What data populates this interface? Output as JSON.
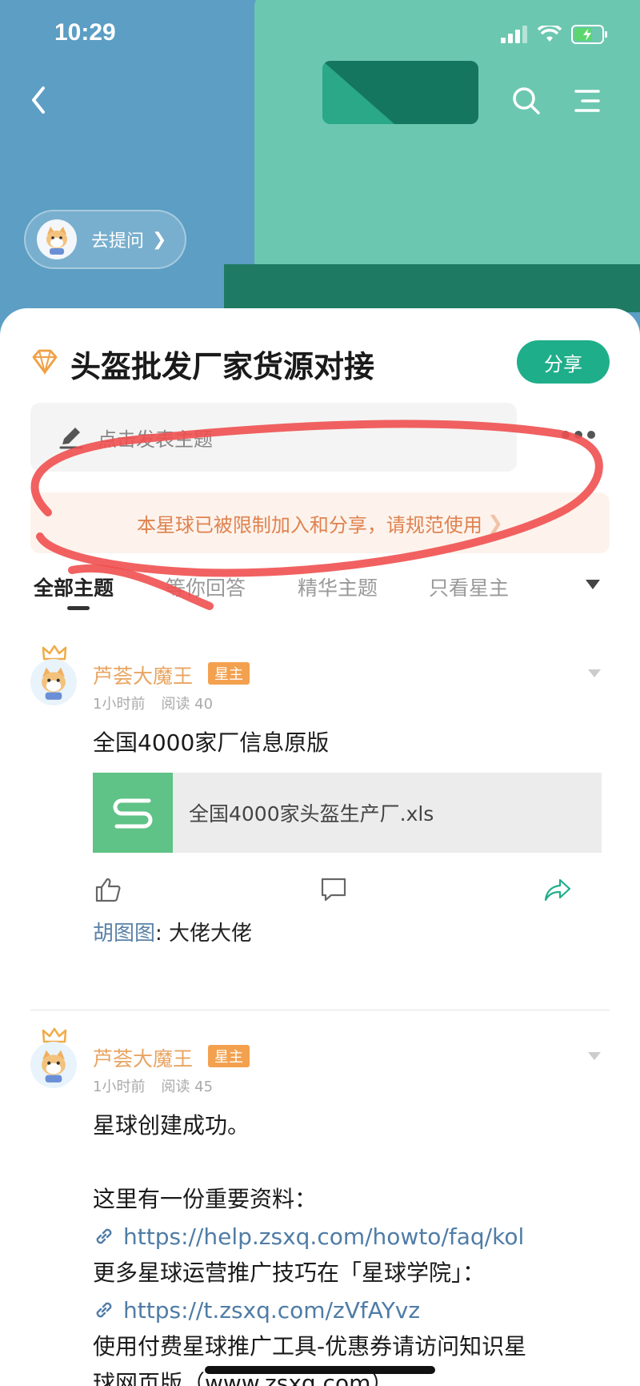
{
  "status_bar": {
    "time": "10:29"
  },
  "header": {
    "ask_label": "去提问"
  },
  "group": {
    "title": "头盔批发厂家货源对接",
    "share_label": "分享",
    "compose_placeholder": "点击发表主题",
    "notice": "本星球已被限制加入和分享，请规范使用"
  },
  "tabs": [
    {
      "label": "全部主题",
      "active": true
    },
    {
      "label": "等你回答",
      "active": false
    },
    {
      "label": "精华主题",
      "active": false
    },
    {
      "label": "只看星主",
      "active": false
    }
  ],
  "posts": [
    {
      "author": "芦荟大魔王",
      "badge": "星主",
      "time": "1小时前",
      "reads": "阅读 40",
      "text": "全国4000家厂信息原版",
      "file_name": "全国4000家头盔生产厂.xls",
      "comment_author": "胡图图",
      "comment_sep": ": ",
      "comment_text": "大佬大佬"
    },
    {
      "author": "芦荟大魔王",
      "badge": "星主",
      "time": "1小时前",
      "reads": "阅读 45",
      "line1": "星球创建成功。",
      "line2": "这里有一份重要资料：",
      "link1": "https://help.zsxq.com/howto/faq/kol",
      "line3": "更多星球运营推广技巧在「星球学院」：",
      "link2": "https://t.zsxq.com/zVfAYvz",
      "line4": "使用付费星球推广工具-优惠券请访问知识星",
      "line5": "球网页版（www.zsxq.com）"
    }
  ],
  "colors": {
    "header_blue": "#5c9ec4",
    "header_green": "#6cc7b0",
    "accent_green": "#1fae8a",
    "notice_orange": "#e0824f",
    "author_orange": "#e8a461",
    "link_blue": "#4f7ca6"
  },
  "icons": [
    "back-icon",
    "logo",
    "search-icon",
    "menu-icon",
    "diamond-icon",
    "pencil-icon",
    "more-icon",
    "chevron-down-icon",
    "crown-icon",
    "like-icon",
    "comment-icon",
    "share-icon",
    "link-icon",
    "file-icon"
  ]
}
